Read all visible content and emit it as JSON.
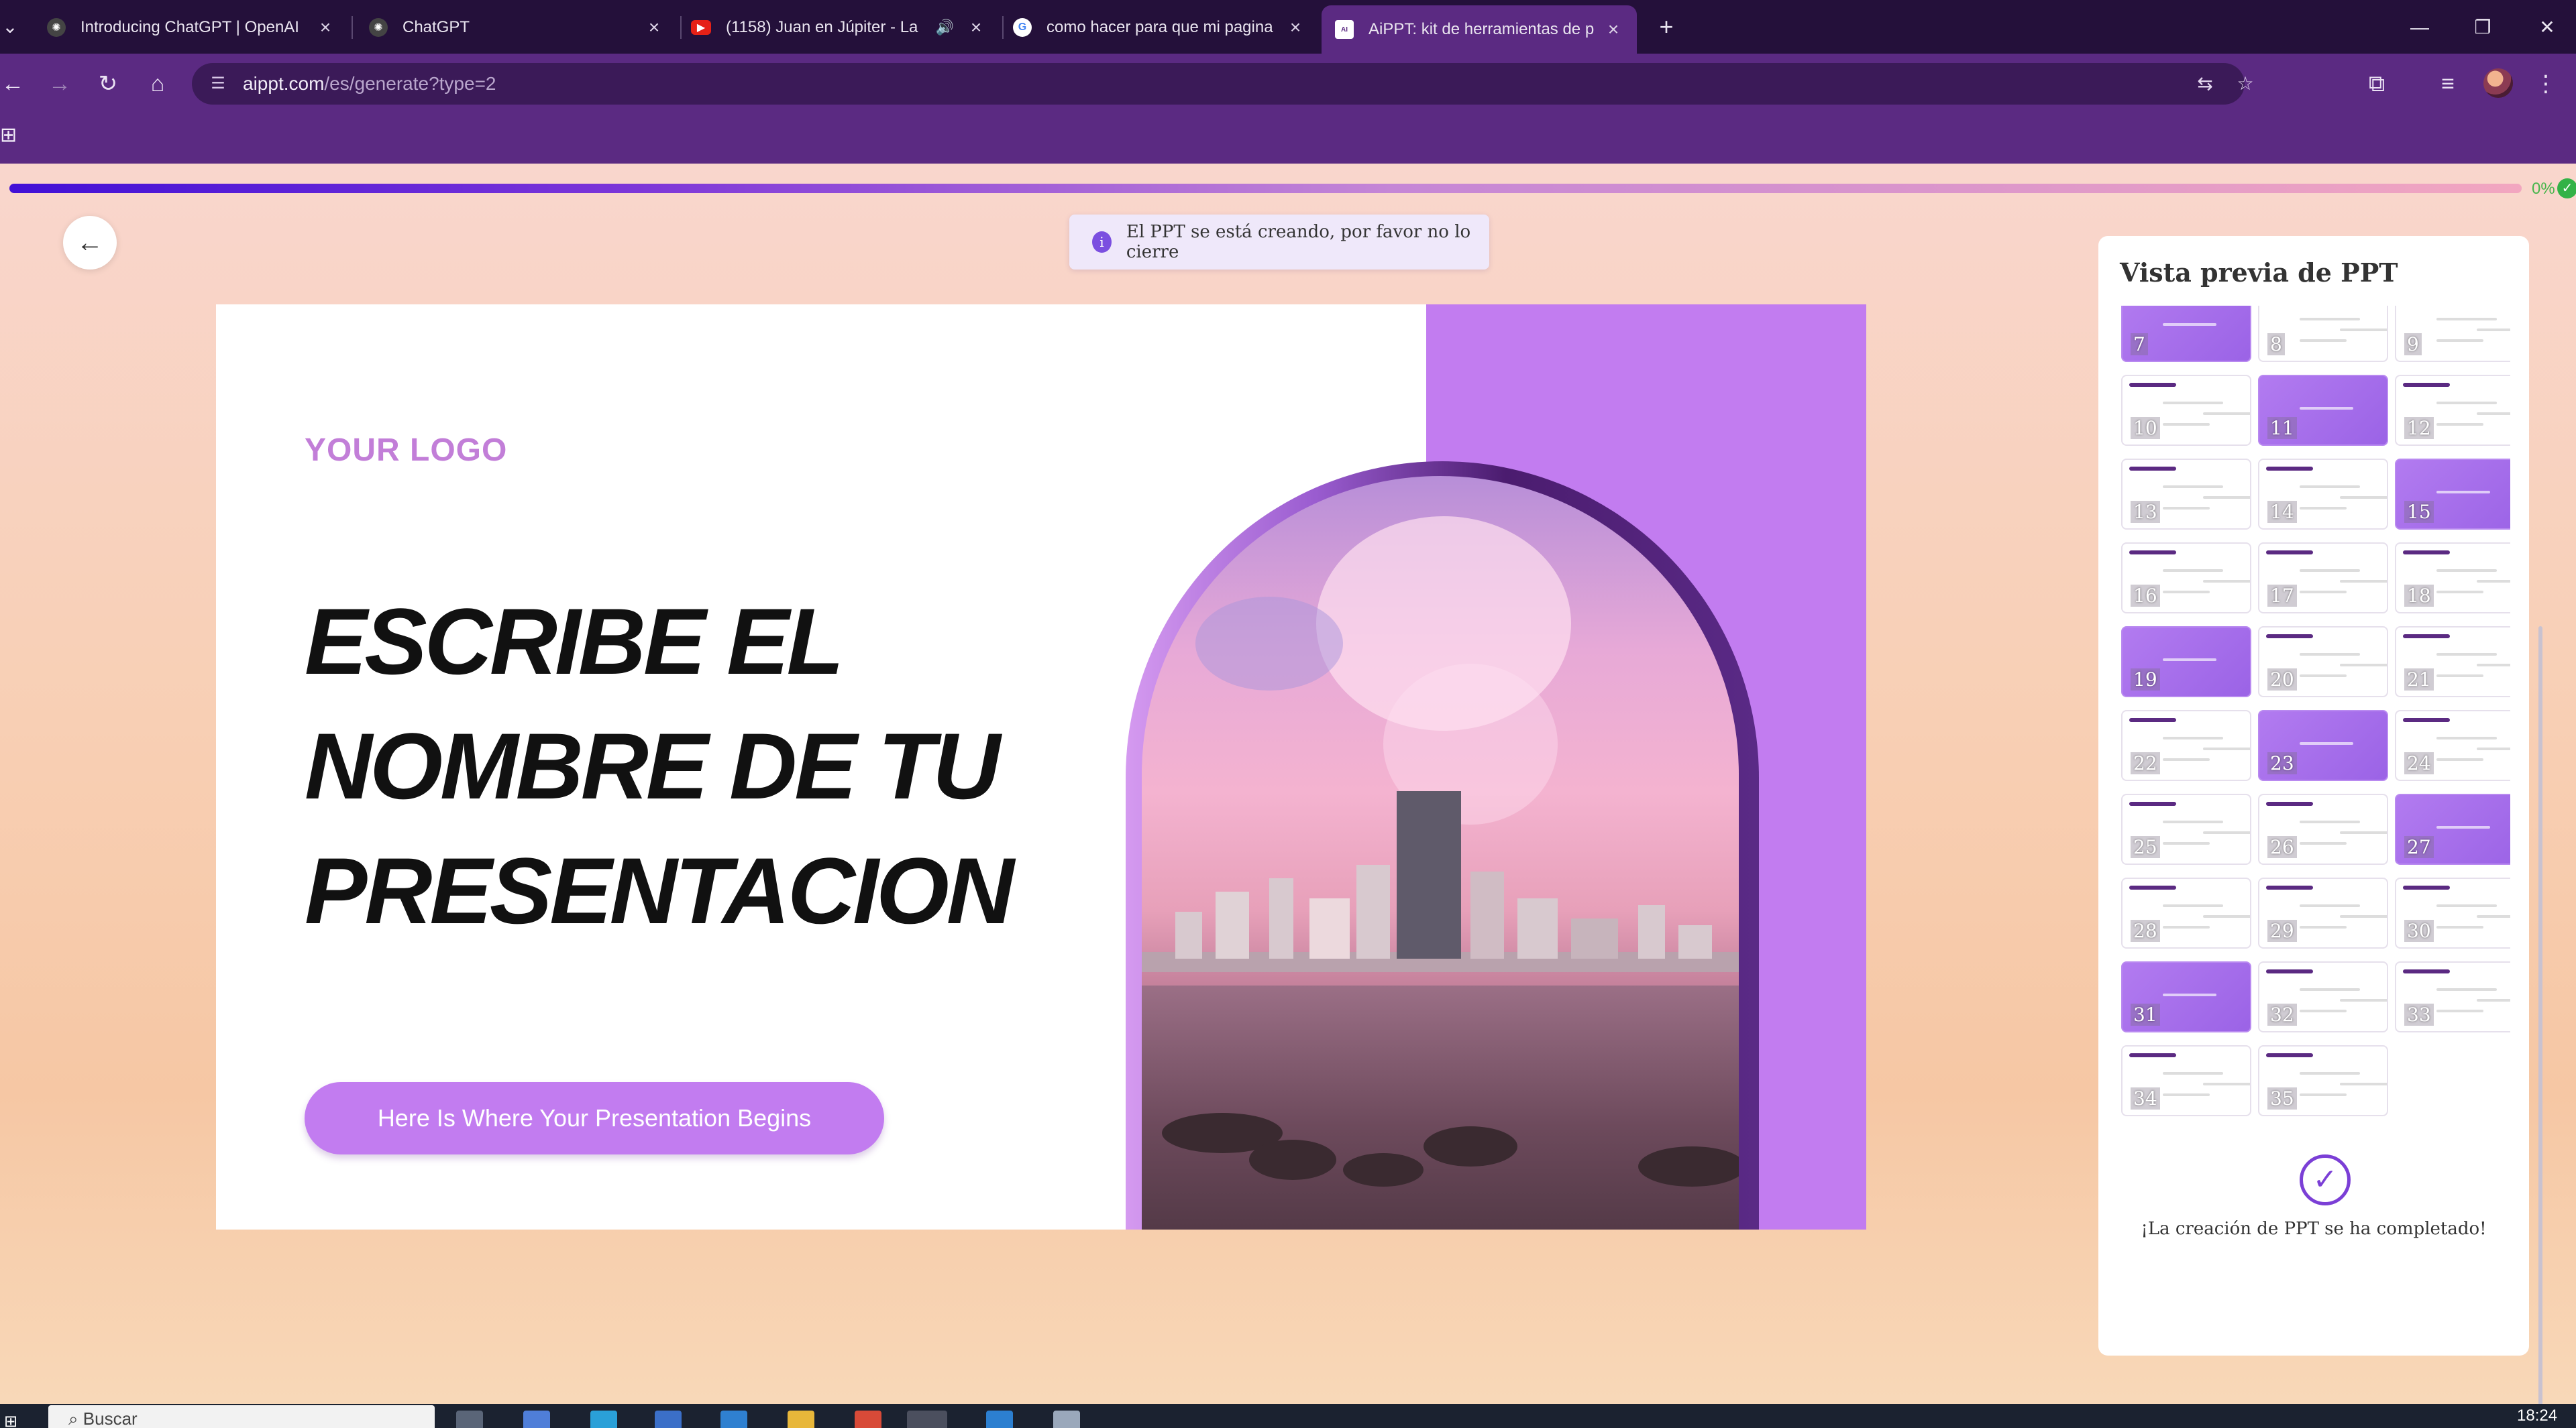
{
  "browser": {
    "tabs": [
      {
        "title": "Introducing ChatGPT | OpenAI",
        "icon": "openai-icon"
      },
      {
        "title": "ChatGPT",
        "icon": "chatgpt-icon"
      },
      {
        "title": "(1158) Juan en Júpiter - La ",
        "icon": "youtube-icon",
        "audio": "speaker-icon"
      },
      {
        "title": "como hacer para que mi pagina",
        "icon": "google-icon"
      },
      {
        "title": "AiPPT: kit de herramientas de p",
        "icon": "aippt-icon"
      }
    ],
    "url_host": "aippt.com",
    "url_path": "/es/generate?type=2"
  },
  "progress": {
    "value": 1.0,
    "label": "0%"
  },
  "toast": {
    "message": "El PPT se está creando, por favor no lo cierre"
  },
  "slide": {
    "logo": "YOUR LOGO",
    "title_line1": "ESCRIBE EL",
    "title_line2": "NOMBRE DE TU",
    "title_line3": "PRESENTACION",
    "button": "Here Is Where Your Presentation Begins"
  },
  "preview": {
    "title": "Vista previa de PPT",
    "thumbnails": [
      "7",
      "8",
      "9",
      "10",
      "11",
      "12",
      "13",
      "14",
      "15",
      "16",
      "17",
      "18",
      "19",
      "20",
      "21",
      "22",
      "23",
      "24",
      "25",
      "26",
      "27",
      "28",
      "29",
      "30",
      "31",
      "32",
      "33",
      "34",
      "35"
    ],
    "done_text": "¡La creación de PPT se ha completado!"
  },
  "taskbar": {
    "search_placeholder": "Buscar",
    "clock": "18:24"
  },
  "colors": {
    "accent": "#c27cf0",
    "chrome": "#5b2a82",
    "success": "#33b247"
  }
}
